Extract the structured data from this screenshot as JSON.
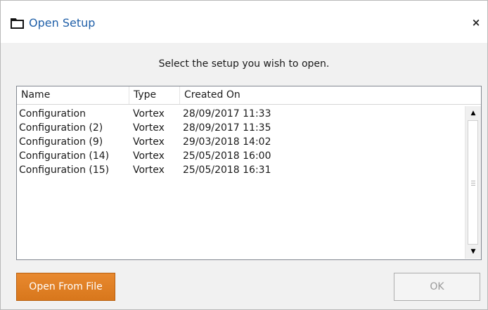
{
  "window": {
    "title": "Open Setup",
    "close_label": "×"
  },
  "instruction": "Select the setup you wish to open.",
  "list": {
    "columns": [
      "Name",
      "Type",
      "Created On"
    ],
    "rows": [
      {
        "name": "Configuration",
        "type": "Vortex",
        "created": "28/09/2017 11:33"
      },
      {
        "name": "Configuration (2)",
        "type": "Vortex",
        "created": "28/09/2017 11:35"
      },
      {
        "name": "Configuration (9)",
        "type": "Vortex",
        "created": "29/03/2018 14:02"
      },
      {
        "name": "Configuration (14)",
        "type": "Vortex",
        "created": "25/05/2018 16:00"
      },
      {
        "name": "Configuration (15)",
        "type": "Vortex",
        "created": "25/05/2018 16:31"
      }
    ]
  },
  "buttons": {
    "open_from_file": "Open From File",
    "ok": "OK"
  },
  "colors": {
    "accent_orange": "#e0801f",
    "title_blue": "#1f5fa8"
  }
}
